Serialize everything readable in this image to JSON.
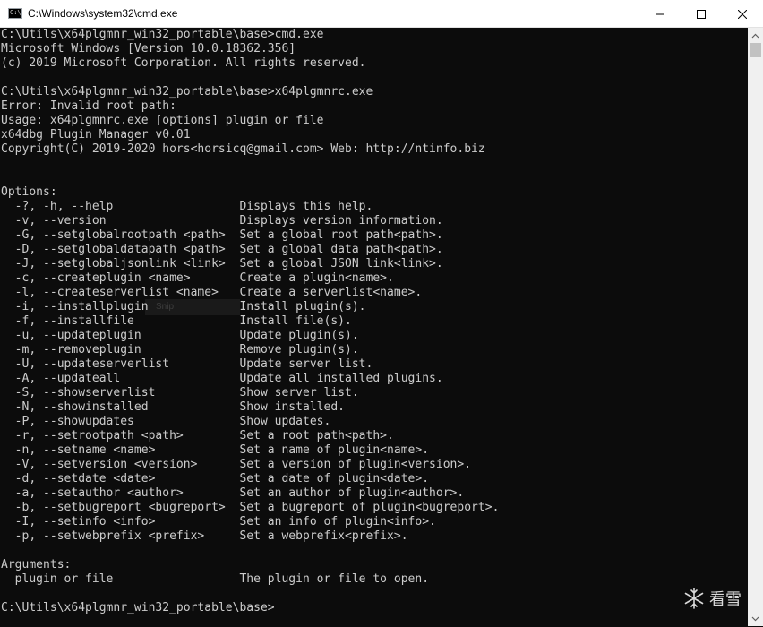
{
  "window": {
    "title": "C:\\Windows\\system32\\cmd.exe",
    "icon_text": "C:\\",
    "buttons": [
      "minimize-icon",
      "maximize-icon",
      "close-icon"
    ]
  },
  "console": {
    "lines": [
      "C:\\Utils\\x64plgmnr_win32_portable\\base>cmd.exe",
      "Microsoft Windows [Version 10.0.18362.356]",
      "(c) 2019 Microsoft Corporation. All rights reserved.",
      "",
      "C:\\Utils\\x64plgmnr_win32_portable\\base>x64plgmnrc.exe",
      "Error: Invalid root path:",
      "Usage: x64plgmnrc.exe [options] plugin or file",
      "x64dbg Plugin Manager v0.01",
      "Copyright(C) 2019-2020 hors<horsicq@gmail.com> Web: http://ntinfo.biz",
      "",
      "",
      "Options:",
      "  -?, -h, --help                  Displays this help.",
      "  -v, --version                   Displays version information.",
      "  -G, --setglobalrootpath <path>  Set a global root path<path>.",
      "  -D, --setglobaldatapath <path>  Set a global data path<path>.",
      "  -J, --setglobaljsonlink <link>  Set a global JSON link<link>.",
      "  -c, --createplugin <name>       Create a plugin<name>.",
      "  -l, --createserverlist <name>   Create a serverlist<name>.",
      "  -i, --installplugin             Install plugin(s).",
      "  -f, --installfile               Install file(s).",
      "  -u, --updateplugin              Update plugin(s).",
      "  -m, --removeplugin              Remove plugin(s).",
      "  -U, --updateserverlist          Update server list.",
      "  -A, --updateall                 Update all installed plugins.",
      "  -S, --showserverlist            Show server list.",
      "  -N, --showinstalled             Show installed.",
      "  -P, --showupdates               Show updates.",
      "  -r, --setrootpath <path>        Set a root path<path>.",
      "  -n, --setname <name>            Set a name of plugin<name>.",
      "  -V, --setversion <version>      Set a version of plugin<version>.",
      "  -d, --setdate <date>            Set a date of plugin<date>.",
      "  -a, --setauthor <author>        Set an author of plugin<author>.",
      "  -b, --setbugreport <bugreport>  Set a bugreport of plugin<bugreport>.",
      "  -I, --setinfo <info>            Set an info of plugin<info>.",
      "  -p, --setwebprefix <prefix>     Set a webprefix<prefix>.",
      "",
      "Arguments:",
      "  plugin or file                  The plugin or file to open.",
      "",
      "C:\\Utils\\x64plgmnr_win32_portable\\base>"
    ]
  },
  "overlay": {
    "snip_text": "Snip"
  },
  "watermark": {
    "text": "看雪",
    "icon": "snowflake-icon"
  },
  "colors": {
    "console_bg": "#0c0c0c",
    "console_fg": "#cccccc",
    "titlebar_bg": "#ffffff",
    "scrollbar_bg": "#f0f0f0"
  }
}
